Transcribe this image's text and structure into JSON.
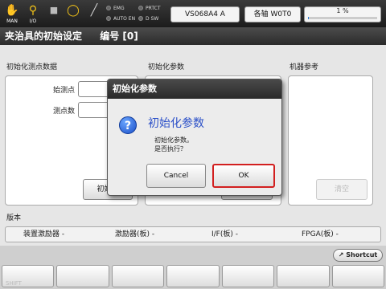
{
  "status_bar": {
    "icons": [
      {
        "name": "man",
        "label": "MAN"
      },
      {
        "name": "io",
        "label": "I/O"
      },
      {
        "name": "stop",
        "label": ""
      },
      {
        "name": "bulb",
        "label": ""
      },
      {
        "name": "tool",
        "label": ""
      }
    ],
    "indicators": [
      {
        "label": "EMG"
      },
      {
        "label": "PRTCT"
      },
      {
        "label": "AUTO EN"
      },
      {
        "label": "D SW"
      }
    ],
    "program_field": "VS068A4 A",
    "axis_field": "各轴 W0T0",
    "progress_text": "1 %",
    "progress_value": 1
  },
  "page": {
    "title": "夹治具的初始设定",
    "number_label": "编号 [0]"
  },
  "init_measure": {
    "title": "初始化测点数据",
    "start_label": "始测点",
    "count_label": "测点数",
    "button": "初始化"
  },
  "init_params": {
    "title": "初始化参数",
    "button": "初始化"
  },
  "device_ref": {
    "title": "机器参考",
    "clear_button": "清空"
  },
  "version": {
    "title": "版本",
    "items": [
      "装置激励器 -",
      "激励器(板) -",
      "I/F(板) -",
      "FPGA(板) -"
    ]
  },
  "shortcut": "Shortcut",
  "fkeys": [
    "SHIFT",
    "",
    "",
    "",
    "",
    "",
    ""
  ],
  "dialog": {
    "title": "初始化参数",
    "heading": "初始化参数",
    "message_line1": "初始化参数。",
    "message_line2": "是否执行？",
    "cancel": "Cancel",
    "ok": "OK"
  }
}
